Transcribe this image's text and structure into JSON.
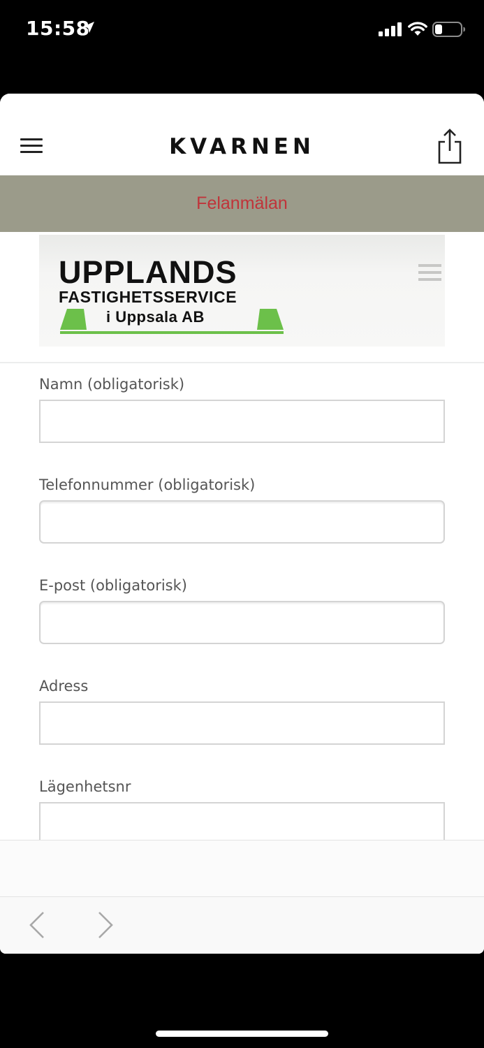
{
  "status_bar": {
    "time": "15:58",
    "icons": [
      "location-arrow-icon",
      "cellular-signal-icon",
      "wifi-icon",
      "battery-icon"
    ]
  },
  "header": {
    "title": "KVARNEN",
    "menu_icon": "hamburger-menu-icon",
    "share_icon": "share-icon"
  },
  "banner": {
    "text": "Felanmälan",
    "background": "#9b9b8a",
    "text_color": "#c0343a"
  },
  "logo": {
    "line1": "UPPLANDS",
    "line2": "FASTIGHETSSERVICE",
    "line3": "i Uppsala AB",
    "accent": "#6cc04a"
  },
  "form": {
    "fields": [
      {
        "label": "Namn (obligatorisk)",
        "value": ""
      },
      {
        "label": "Telefonnummer (obligatorisk)",
        "value": ""
      },
      {
        "label": "E-post (obligatorisk)",
        "value": ""
      },
      {
        "label": "Adress",
        "value": ""
      },
      {
        "label": "Lägenhetsnr",
        "value": ""
      }
    ]
  },
  "toolbar": {
    "back_icon": "chevron-left-icon",
    "forward_icon": "chevron-right-icon"
  }
}
